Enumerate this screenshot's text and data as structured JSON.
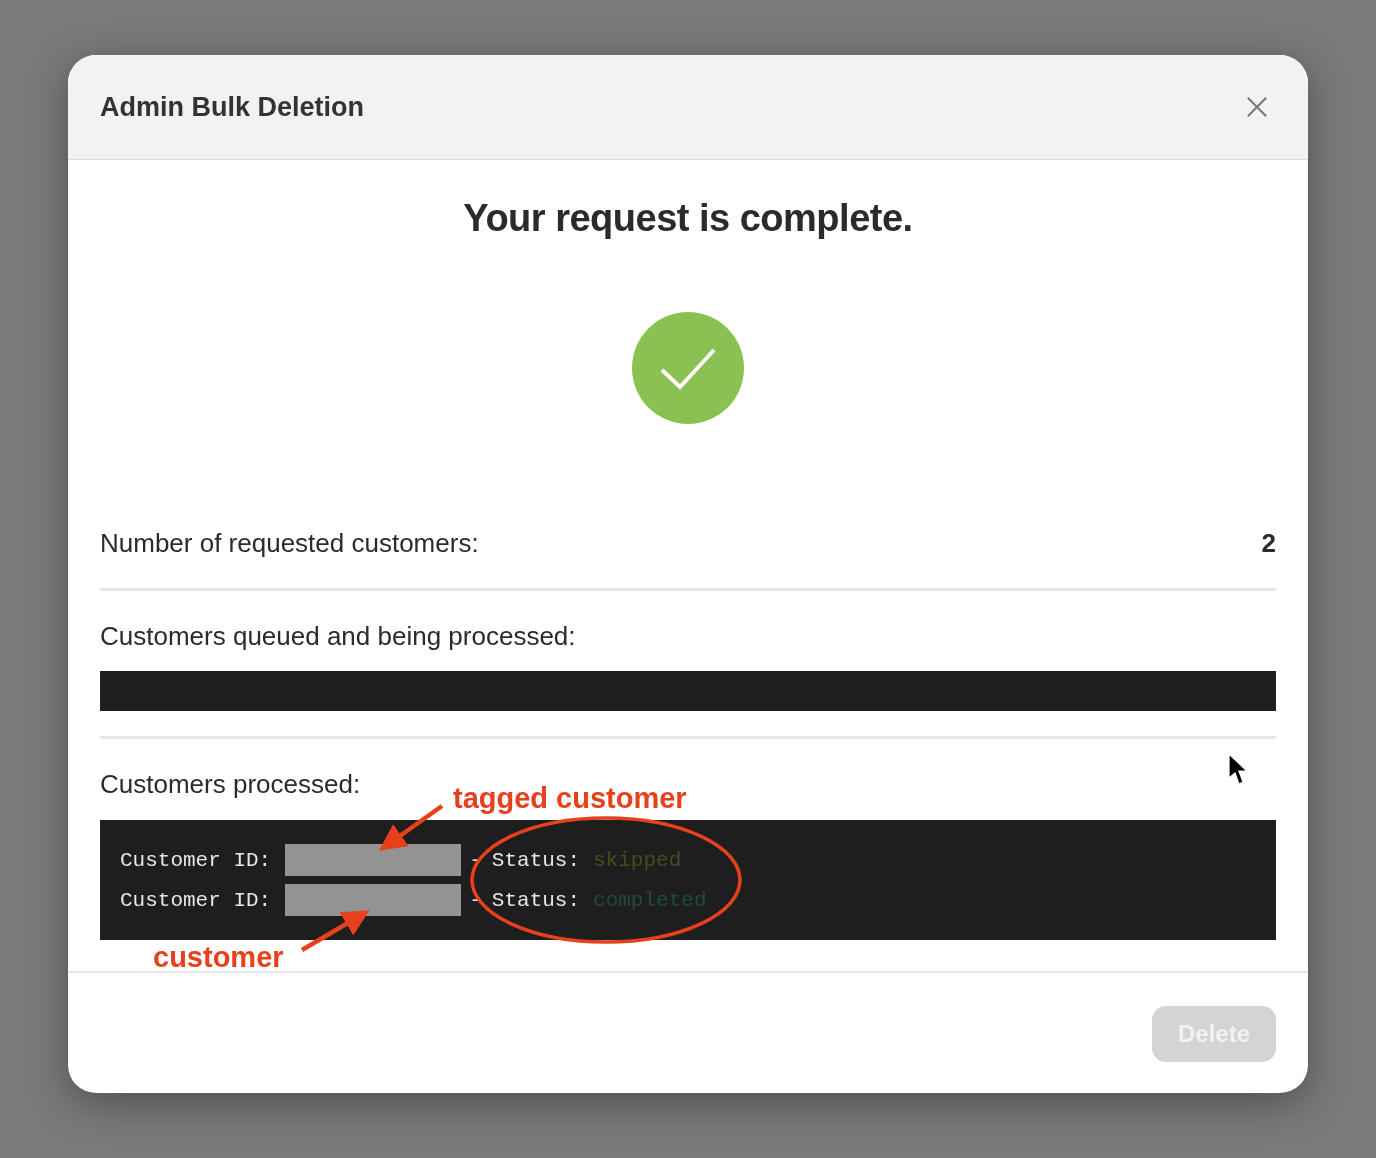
{
  "dialog": {
    "title": "Admin Bulk Deletion",
    "heading": "Your request is complete.",
    "stats": [
      {
        "label": "Number of requested customers:",
        "value": "2"
      }
    ],
    "queued": {
      "label": "Customers queued and being processed:"
    },
    "processed": {
      "label": "Customers processed:",
      "lines": [
        {
          "label": "Customer ID:",
          "separator": "-",
          "status_label": "Status:",
          "status": "skipped",
          "color": "#4b4a1f"
        },
        {
          "label": "Customer ID:",
          "separator": "-",
          "status_label": "Status:",
          "status": "completed",
          "color": "#1e4a43"
        }
      ]
    },
    "buttons": [
      {
        "label": "Delete",
        "disabled": true
      }
    ]
  },
  "annotations": [
    {
      "kind": "arrow-label",
      "text": "tagged customer"
    },
    {
      "kind": "arrow-label",
      "text": "customer"
    },
    {
      "kind": "ellipse"
    }
  ]
}
